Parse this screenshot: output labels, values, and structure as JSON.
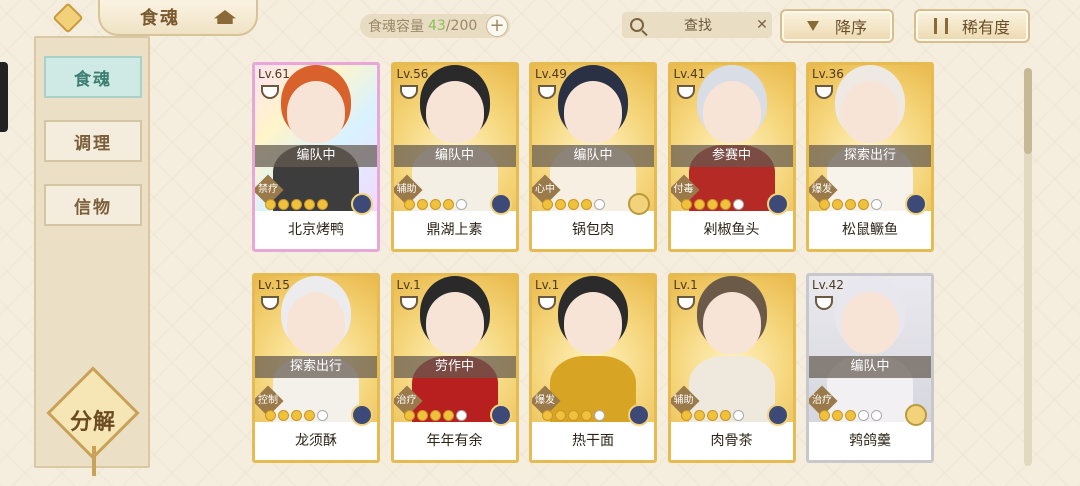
{
  "header": {
    "title": "食魂",
    "capacity_label": "食魂容量",
    "capacity_current": "43",
    "capacity_total": "/200",
    "plus_label": "+",
    "search_label": "查找",
    "search_clear": "✕",
    "sort_order_label": "降序",
    "sort_rarity_label": "稀有度"
  },
  "sidebar": {
    "items": [
      {
        "label": "食魂",
        "active": true
      },
      {
        "label": "调理",
        "active": false
      },
      {
        "label": "信物",
        "active": false
      }
    ],
    "decompose_label": "分解"
  },
  "cards": [
    {
      "level": "Lv.61",
      "status": "编队中",
      "role": "禁疗",
      "name": "北京烤鸭",
      "rarity": "sp",
      "stars": 5,
      "medal": "blue",
      "hair": "#d8612c",
      "cloth": "#3d3d3d"
    },
    {
      "level": "Lv.56",
      "status": "编队中",
      "role": "辅助",
      "name": "鼎湖上素",
      "rarity": "ur",
      "stars": 4,
      "medal": "blue",
      "hair": "#2a2a2a",
      "cloth": "#f3efe4"
    },
    {
      "level": "Lv.49",
      "status": "编队中",
      "role": "心中",
      "name": "锅包肉",
      "rarity": "ur",
      "stars": 4,
      "medal": "gold",
      "hair": "#2b3145",
      "cloth": "#f6efe2"
    },
    {
      "level": "Lv.41",
      "status": "参赛中",
      "role": "付毒",
      "name": "剁椒鱼头",
      "rarity": "ur",
      "stars": 4,
      "medal": "blue",
      "hair": "#d9dde6",
      "cloth": "#b52a24"
    },
    {
      "level": "Lv.36",
      "status": "探索出行",
      "role": "爆发",
      "name": "松鼠鳜鱼",
      "rarity": "ur",
      "stars": 4,
      "medal": "blue",
      "hair": "#efe9e4",
      "cloth": "#f7f2ea"
    },
    {
      "level": "Lv.15",
      "status": "探索出行",
      "role": "控制",
      "name": "龙须酥",
      "rarity": "ur",
      "stars": 4,
      "medal": "blue",
      "hair": "#ecebee",
      "cloth": "#f4f1ea"
    },
    {
      "level": "Lv.1",
      "status": "劳作中",
      "role": "治疗",
      "name": "年年有余",
      "rarity": "ur",
      "stars": 4,
      "medal": "blue",
      "hair": "#2a2a2a",
      "cloth": "#b82020"
    },
    {
      "level": "Lv.1",
      "status": "",
      "role": "爆发",
      "name": "热干面",
      "rarity": "ur",
      "stars": 4,
      "medal": "blue",
      "hair": "#2b2b2b",
      "cloth": "#d8a424"
    },
    {
      "level": "Lv.1",
      "status": "",
      "role": "辅助",
      "name": "肉骨茶",
      "rarity": "ur",
      "stars": 4,
      "medal": "blue",
      "hair": "#6b5a48",
      "cloth": "#efe8dc"
    },
    {
      "level": "Lv.42",
      "status": "编队中",
      "role": "治疗",
      "name": "鹁鸽羹",
      "rarity": "m",
      "stars": 3,
      "medal": "gold",
      "hair": "#e9e7ee",
      "cloth": "#f3f0f4"
    }
  ],
  "colors": {
    "accent_gold": "#e4b84d",
    "active_tab": "#cfe9e4",
    "capacity_current": "#8fbf5a"
  }
}
